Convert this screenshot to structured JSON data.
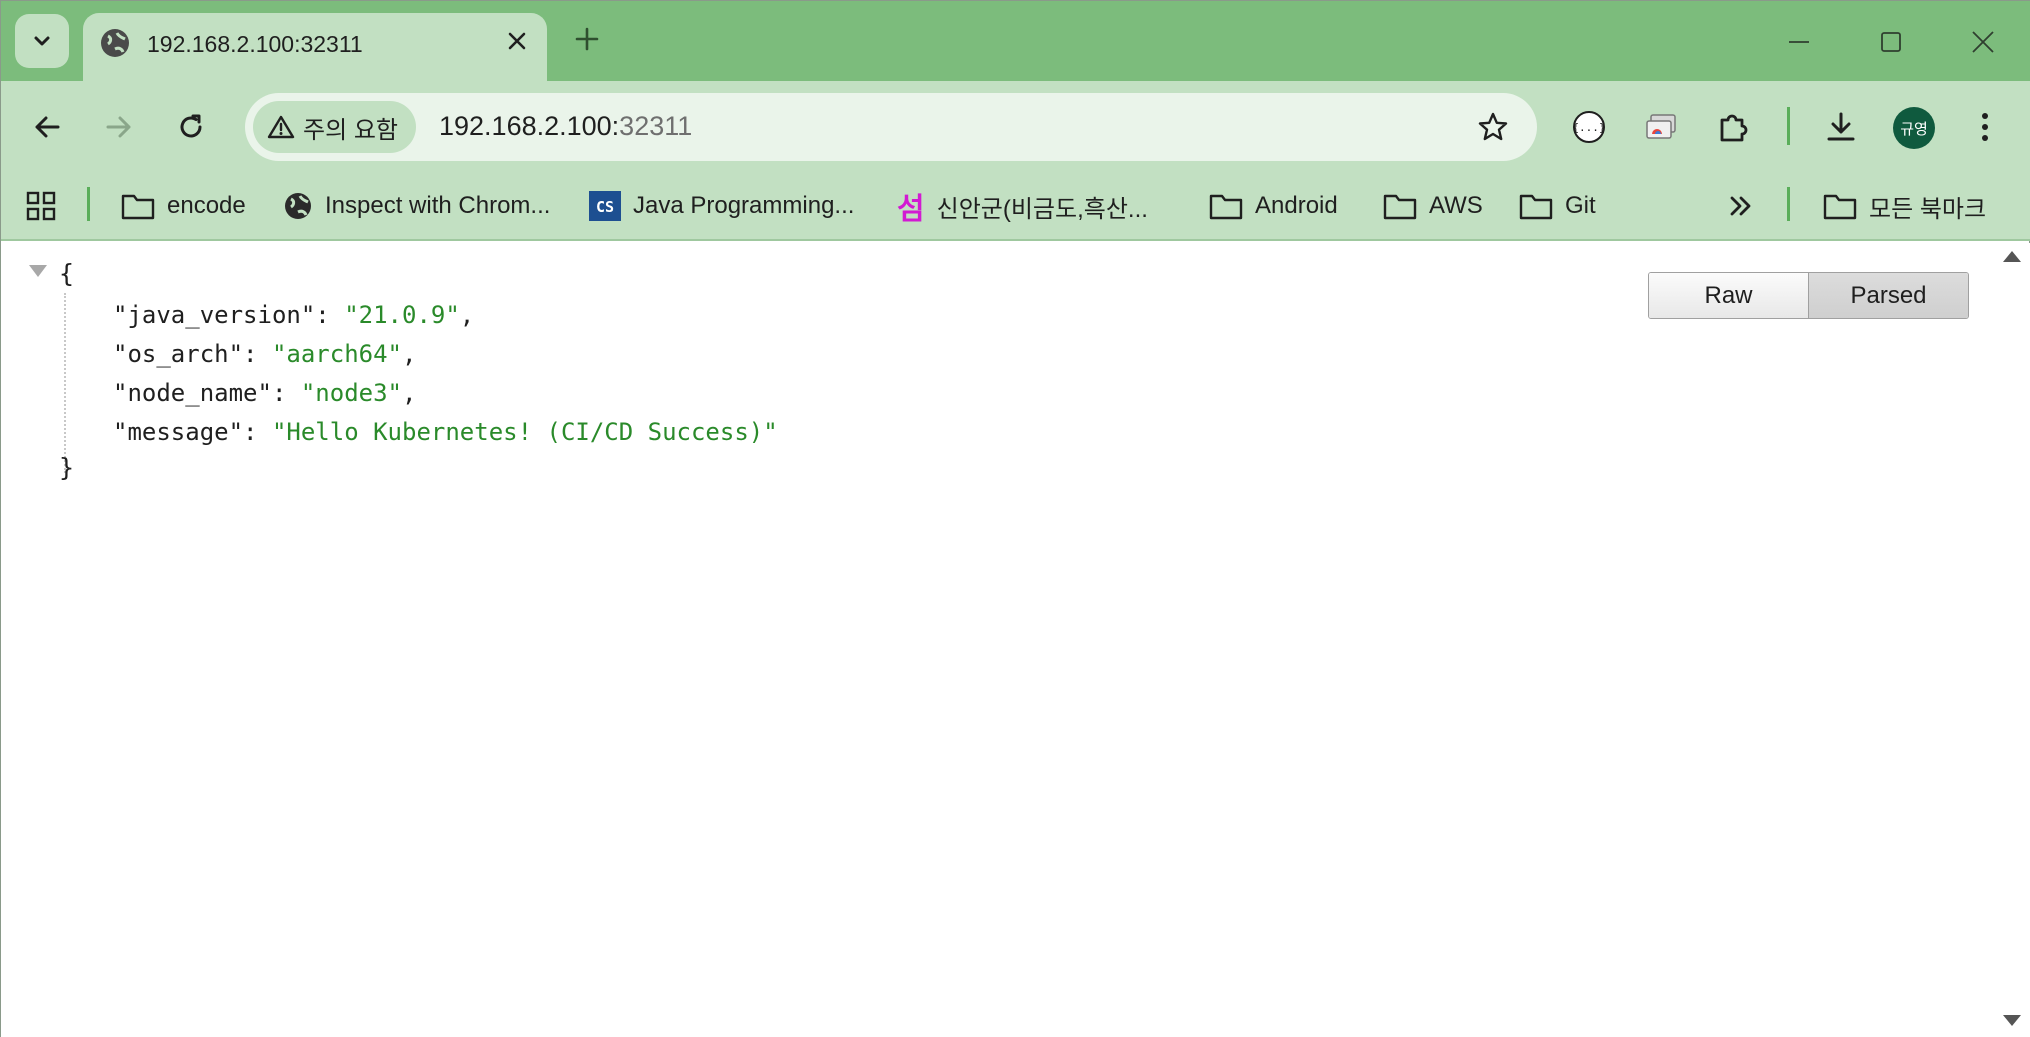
{
  "tab": {
    "title": "192.168.2.100:32311"
  },
  "omnibox": {
    "security_chip": "주의 요함",
    "url_host": "192.168.2.100:",
    "url_port": "32311"
  },
  "profile": {
    "avatar_text": "규영"
  },
  "bookmarks": {
    "items": [
      {
        "label": "encode",
        "icon": "folder-icon"
      },
      {
        "label": "Inspect with Chrom...",
        "icon": "globe-icon"
      },
      {
        "label": "Java Programming...",
        "icon": "cs-logo-icon"
      },
      {
        "label": "신안군(비금도,흑산...",
        "icon": "seom-logo-icon"
      },
      {
        "label": "Android",
        "icon": "folder-icon"
      },
      {
        "label": "AWS",
        "icon": "folder-icon"
      },
      {
        "label": "Git",
        "icon": "folder-icon"
      }
    ],
    "all_bookmarks": "모든 북마크",
    "seom_glyph": "섬",
    "cs_glyph": "CS"
  },
  "json_viewer": {
    "open_brace": "{",
    "close_brace": "}",
    "entries": [
      {
        "key": "\"java_version\"",
        "value": "\"21.0.9\"",
        "trail": ","
      },
      {
        "key": "\"os_arch\"",
        "value": "\"aarch64\"",
        "trail": ","
      },
      {
        "key": "\"node_name\"",
        "value": "\"node3\"",
        "trail": ","
      },
      {
        "key": "\"message\"",
        "value": "\"Hello Kubernetes! (CI/CD Success)\"",
        "trail": ""
      }
    ],
    "raw_label": "Raw",
    "parsed_label": "Parsed",
    "active_view": "Parsed"
  },
  "colors": {
    "tabstrip": "#7cbc7c",
    "toolbar": "#c2e0c2",
    "json_string": "#2a8a2a",
    "avatar_bg": "#0f5a3e"
  }
}
